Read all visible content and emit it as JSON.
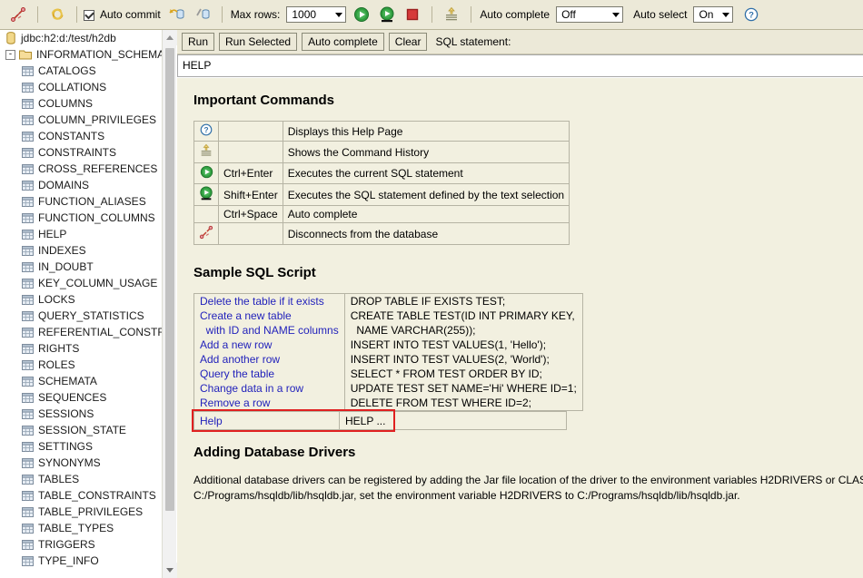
{
  "toolbar": {
    "disconnect_icon": "disconnect-icon",
    "refresh_icon": "refresh-icon",
    "auto_commit_label": "Auto commit",
    "auto_commit_checked": true,
    "commit_icon": "commit-icon",
    "rollback_icon": "rollback-icon",
    "max_rows_label": "Max rows:",
    "max_rows_value": "1000",
    "run_icon": "run-icon",
    "run_selected_icon": "run-selected-icon",
    "stop_icon": "stop-icon",
    "history_icon": "command-history-icon",
    "auto_complete_label": "Auto complete",
    "auto_complete_value": "Off",
    "auto_select_label": "Auto select",
    "auto_select_value": "On",
    "help_icon": "help-icon"
  },
  "sql_bar": {
    "run_label": "Run",
    "run_selected_label": "Run Selected",
    "auto_complete_label": "Auto complete",
    "clear_label": "Clear",
    "caption": "SQL statement:",
    "statement_value": "HELP",
    "statement_placeholder": ""
  },
  "tree": {
    "root_label": "jdbc:h2:d:/test/h2db",
    "schema_label": "INFORMATION_SCHEMA",
    "schema_expanded": "-",
    "tables": [
      "CATALOGS",
      "COLLATIONS",
      "COLUMNS",
      "COLUMN_PRIVILEGES",
      "CONSTANTS",
      "CONSTRAINTS",
      "CROSS_REFERENCES",
      "DOMAINS",
      "FUNCTION_ALIASES",
      "FUNCTION_COLUMNS",
      "HELP",
      "INDEXES",
      "IN_DOUBT",
      "KEY_COLUMN_USAGE",
      "LOCKS",
      "QUERY_STATISTICS",
      "REFERENTIAL_CONSTR",
      "RIGHTS",
      "ROLES",
      "SCHEMATA",
      "SEQUENCES",
      "SESSIONS",
      "SESSION_STATE",
      "SETTINGS",
      "SYNONYMS",
      "TABLES",
      "TABLE_CONSTRAINTS",
      "TABLE_PRIVILEGES",
      "TABLE_TYPES",
      "TRIGGERS",
      "TYPE_INFO"
    ]
  },
  "content": {
    "commands_heading": "Important Commands",
    "commands": [
      {
        "icon": "help-icon",
        "key": "",
        "desc": "Displays this Help Page"
      },
      {
        "icon": "history-icon",
        "key": "",
        "desc": "Shows the Command History"
      },
      {
        "icon": "run-icon",
        "key": "Ctrl+Enter",
        "desc": "Executes the current SQL statement"
      },
      {
        "icon": "run-selected-icon",
        "key": "Shift+Enter",
        "desc": "Executes the SQL statement defined by the text selection"
      },
      {
        "icon": "",
        "key": "Ctrl+Space",
        "desc": "Auto complete"
      },
      {
        "icon": "disconnect-icon",
        "key": "",
        "desc": "Disconnects from the database"
      }
    ],
    "sample_heading": "Sample SQL Script",
    "sample_desc_lines": [
      "Delete the table if it exists",
      "Create a new table",
      "  with ID and NAME columns",
      "Add a new row",
      "Add another row",
      "Query the table",
      "Change data in a row",
      "Remove a row"
    ],
    "sample_code_lines": [
      "DROP TABLE IF EXISTS TEST;",
      "CREATE TABLE TEST(ID INT PRIMARY KEY,",
      "  NAME VARCHAR(255));",
      "INSERT INTO TEST VALUES(1, 'Hello');",
      "INSERT INTO TEST VALUES(2, 'World');",
      "SELECT * FROM TEST ORDER BY ID;",
      "UPDATE TEST SET NAME='Hi' WHERE ID=1;",
      "DELETE FROM TEST WHERE ID=2;"
    ],
    "help_row_desc": "Help",
    "help_row_code": "HELP ...",
    "drivers_heading": "Adding Database Drivers",
    "drivers_paragraph_line1": "Additional database drivers can be registered by adding the Jar file location of the driver to the environment variables H2DRIVERS or CLAS",
    "drivers_paragraph_line2": "C:/Programs/hsqldb/lib/hsqldb.jar, set the environment variable H2DRIVERS to C:/Programs/hsqldb/lib/hsqldb.jar."
  },
  "colors": {
    "toolbar_bg": "#ece9d8",
    "content_bg": "#f2f0e0",
    "link_blue": "#2222bb",
    "highlight_red": "#e02020",
    "run_green": "#1e8a2e",
    "stop_red": "#cc2222"
  }
}
